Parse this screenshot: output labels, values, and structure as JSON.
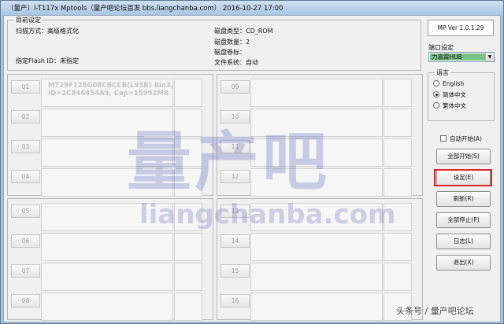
{
  "window": {
    "title": "（量产）I-T117x Mptools（量产吧论坛首发 bbs.liangchanba.com）  2016-10-27 17:00"
  },
  "info": {
    "legend": "目前设定",
    "scan_mode": "扫描方式：高级格式化",
    "flash_id": "指定Flash ID：未指定",
    "disk_type": "磁盘类型：CD_ROM",
    "disk_count": "磁盘数量：2",
    "disk_label": "磁盘卷标：",
    "file_system": "文件系统：自动"
  },
  "ports": [
    {
      "num": "01",
      "info_line1": "MT29F128G08CBCCB(L95B) Bin3,",
      "info_line2": "ID=2C846454A9, Cap=15992MB"
    },
    {
      "num": "02",
      "info_line1": "",
      "info_line2": ""
    },
    {
      "num": "03",
      "info_line1": "",
      "info_line2": ""
    },
    {
      "num": "04",
      "info_line1": "",
      "info_line2": ""
    },
    {
      "num": "05",
      "info_line1": "",
      "info_line2": ""
    },
    {
      "num": "06",
      "info_line1": "",
      "info_line2": ""
    },
    {
      "num": "07",
      "info_line1": "",
      "info_line2": ""
    },
    {
      "num": "08",
      "info_line1": "",
      "info_line2": ""
    },
    {
      "num": "09",
      "info_line1": "",
      "info_line2": ""
    },
    {
      "num": "10",
      "info_line1": "",
      "info_line2": ""
    },
    {
      "num": "11",
      "info_line1": "",
      "info_line2": ""
    },
    {
      "num": "12",
      "info_line1": "",
      "info_line2": ""
    },
    {
      "num": "13",
      "info_line1": "",
      "info_line2": ""
    },
    {
      "num": "14",
      "info_line1": "",
      "info_line2": ""
    },
    {
      "num": "15",
      "info_line1": "",
      "info_line2": ""
    },
    {
      "num": "16",
      "info_line1": "",
      "info_line2": ""
    }
  ],
  "right": {
    "version": "MP Ver 1.0.1.29",
    "hub_label": "端口设定",
    "hub_value": "力喜霖HUB",
    "lang_legend": "语言",
    "lang_options": [
      "English",
      "简体中文",
      "繁体中文"
    ],
    "lang_selected": 1,
    "auto_start": "自动开始(A)",
    "buttons": {
      "start_all": "全部开始(S)",
      "settings": "设定(E)",
      "refresh": "刷新(R)",
      "stop_all": "全部停止(P)",
      "log": "日志(L)",
      "exit": "退出(X)"
    }
  },
  "watermark": {
    "cn": "量产吧",
    "en": "liangchanba.com"
  },
  "credit": "头条号 / 量产吧论坛",
  "colors": {
    "highlight": "#d8262d",
    "hub_bg": "#7ec28b",
    "watermark": "#5c68ba"
  }
}
